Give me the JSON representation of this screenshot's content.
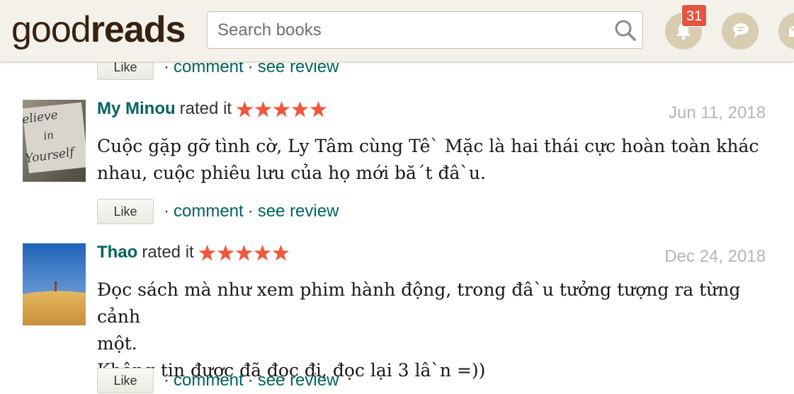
{
  "header": {
    "logo_part1": "good",
    "logo_part2": "reads",
    "search_placeholder": "Search books",
    "notification_count": "31"
  },
  "top_actions": {
    "comment_label": "comment",
    "see_review_label": "see review",
    "like_label": "Like",
    "separator": "·"
  },
  "reviews": [
    {
      "reviewer": "My Minou",
      "rated_text": "rated it",
      "rating": 5,
      "date": "Jun 11, 2018",
      "text_lines": [
        "Cuộc gặp gỡ tình cờ, Ly Tâm cùng Tê` Mặc là hai thái cực hoàn toàn khác",
        "nhau, cuộc phiêu lưu của họ mới bă´t đâ`u."
      ],
      "like_label": "Like",
      "comment_label": "comment",
      "see_review_label": "see review",
      "avatar_text": [
        "elieve",
        "in",
        "Yourself"
      ]
    },
    {
      "reviewer": "Thao",
      "rated_text": "rated it",
      "rating": 5,
      "date": "Dec 24, 2018",
      "text_lines": [
        "Đọc sách mà như xem phim hành động, trong đâ`u tưởng tượng ra từng cảnh",
        "một.",
        "Không tin được đã đọc đi, đọc lại 3 lâ`n =))"
      ],
      "like_label": "Like",
      "comment_label": "comment",
      "see_review_label": "see review"
    }
  ],
  "colors": {
    "header_bg": "#f4f1ea",
    "link": "#00635d",
    "star": "#f0573c",
    "badge": "#e4553f",
    "date": "#b5b5b5"
  }
}
